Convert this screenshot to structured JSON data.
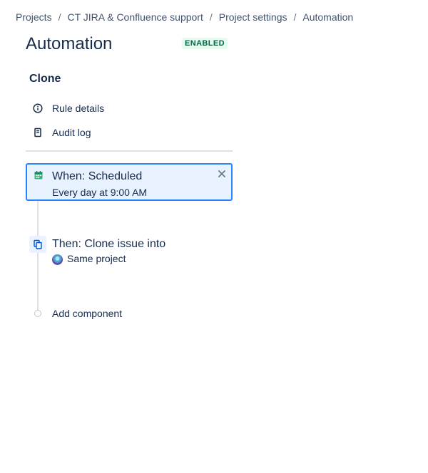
{
  "breadcrumb": {
    "items": [
      "Projects",
      "CT JIRA & Confluence support",
      "Project settings",
      "Automation"
    ],
    "separator": "/"
  },
  "page": {
    "title": "Automation",
    "status": "ENABLED"
  },
  "rule": {
    "name": "Clone",
    "nav": [
      {
        "label": "Rule details",
        "icon": "info-icon"
      },
      {
        "label": "Audit log",
        "icon": "document-icon"
      }
    ]
  },
  "trigger": {
    "title": "When: Scheduled",
    "subtitle": "Every day at 9:00 AM",
    "icon": "calendar-icon"
  },
  "action": {
    "title": "Then: Clone issue into",
    "subtitle": "Same project",
    "icon": "copy-icon"
  },
  "add_component": {
    "label": "Add component"
  },
  "colors": {
    "accent": "#2684ff",
    "selected_bg": "#e9f2ff",
    "enabled_bg": "#e3fcef",
    "enabled_text": "#006644",
    "calendar_icon": "#36b37e"
  }
}
